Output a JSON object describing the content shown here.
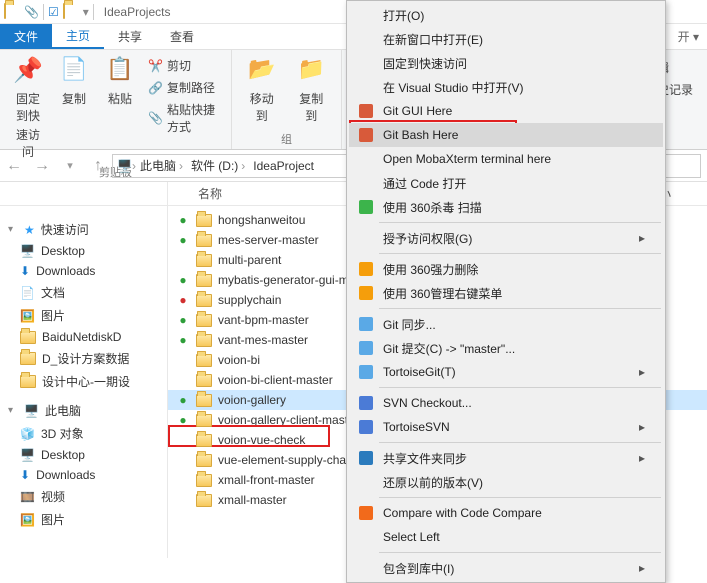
{
  "titlebar": {
    "app_title": "IdeaProjects"
  },
  "ribbon_tabs": {
    "file": "文件",
    "home": "主页",
    "share": "共享",
    "view": "查看"
  },
  "ribbon": {
    "pin": {
      "line1": "固定到快",
      "line2": "速访问"
    },
    "copy": "复制",
    "paste": "粘贴",
    "cut": "剪切",
    "copypath": "复制路径",
    "pasteshortcut": "粘贴快捷方式",
    "clipboard_group": "剪贴板",
    "moveto": "移动到",
    "copyto": "复制到",
    "org_group": "组",
    "open_dd": "开",
    "edit": "辑",
    "history": "史记录"
  },
  "breadcrumb": {
    "p1": "此电脑",
    "p2": "软件 (D:)",
    "p3": "IdeaProject"
  },
  "columns": {
    "name": "名称",
    "size": "大小"
  },
  "nav": {
    "quick_access": "快速访问",
    "desktop": "Desktop",
    "downloads": "Downloads",
    "documents": "文档",
    "pictures": "图片",
    "baidu": "BaiduNetdiskD",
    "d_design": "D_设计方案数据",
    "design_center": "设计中心-一期设",
    "this_pc": "此电脑",
    "3d": "3D 对象",
    "desktop2": "Desktop",
    "downloads2": "Downloads",
    "videos": "视频",
    "pictures2": "图片"
  },
  "files": [
    {
      "name": "hongshanweitou",
      "ov": "ok"
    },
    {
      "name": "mes-server-master",
      "ov": "ok"
    },
    {
      "name": "multi-parent",
      "ov": ""
    },
    {
      "name": "mybatis-generator-gui-m",
      "ov": "ok"
    },
    {
      "name": "supplychain",
      "ov": "err"
    },
    {
      "name": "vant-bpm-master",
      "ov": "ok"
    },
    {
      "name": "vant-mes-master",
      "ov": "ok"
    },
    {
      "name": "voion-bi",
      "ov": ""
    },
    {
      "name": "voion-bi-client-master",
      "ov": ""
    },
    {
      "name": "voion-gallery",
      "ov": "ok",
      "selected": true
    },
    {
      "name": "voion-gallery-client-maste",
      "ov": "ok"
    },
    {
      "name": "voion-vue-check",
      "ov": ""
    },
    {
      "name": "vue-element-supply-chain",
      "ov": ""
    },
    {
      "name": "xmall-front-master",
      "ov": ""
    },
    {
      "name": "xmall-master",
      "ov": ""
    }
  ],
  "context_menu": [
    {
      "label": "打开(O)",
      "icon": ""
    },
    {
      "label": "在新窗口中打开(E)",
      "icon": ""
    },
    {
      "label": "固定到快速访问",
      "icon": ""
    },
    {
      "label": "在 Visual Studio 中打开(V)",
      "icon": ""
    },
    {
      "label": "Git GUI Here",
      "icon": "git",
      "color": "#d85a3a"
    },
    {
      "label": "Git Bash Here",
      "icon": "git",
      "color": "#d85a3a",
      "hover": true
    },
    {
      "label": "Open MobaXterm terminal here",
      "icon": ""
    },
    {
      "label": "通过 Code 打开",
      "icon": ""
    },
    {
      "label": "使用 360杀毒 扫描",
      "icon": "360",
      "color": "#3cb44b"
    },
    {
      "sep": true
    },
    {
      "label": "授予访问权限(G)",
      "icon": "",
      "sub": true
    },
    {
      "sep": true
    },
    {
      "label": "使用 360强力删除",
      "icon": "360o",
      "color": "#f59e0b"
    },
    {
      "label": "使用 360管理右键菜单",
      "icon": "360o",
      "color": "#f59e0b"
    },
    {
      "sep": true
    },
    {
      "label": "Git 同步...",
      "icon": "tort",
      "color": "#5aa9e6"
    },
    {
      "label": "Git 提交(C) -> \"master\"...",
      "icon": "tort",
      "color": "#5aa9e6"
    },
    {
      "label": "TortoiseGit(T)",
      "icon": "tort",
      "color": "#5aa9e6",
      "sub": true
    },
    {
      "sep": true
    },
    {
      "label": "SVN Checkout...",
      "icon": "svn",
      "color": "#4b7bd6"
    },
    {
      "label": "TortoiseSVN",
      "icon": "svn",
      "color": "#4b7bd6",
      "sub": true
    },
    {
      "sep": true
    },
    {
      "label": "共享文件夹同步",
      "icon": "sync",
      "color": "#2b7bbd",
      "sub": true
    },
    {
      "label": "还原以前的版本(V)",
      "icon": ""
    },
    {
      "sep": true
    },
    {
      "label": "Compare with Code Compare",
      "icon": "cc",
      "color": "#f26a1b"
    },
    {
      "label": "Select Left",
      "icon": ""
    },
    {
      "sep": true
    },
    {
      "label": "包含到库中(I)",
      "icon": "",
      "sub": true
    }
  ]
}
